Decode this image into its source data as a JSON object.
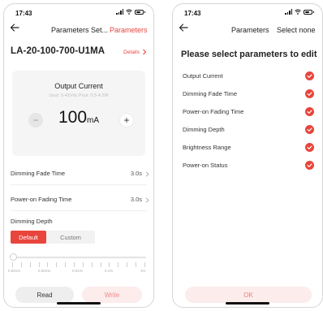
{
  "theme": {
    "accent": "#e8453c",
    "accent_soft": "#fdecec",
    "card_bg": "#f5f5f5"
  },
  "left_screen": {
    "status_time": "17:43",
    "nav_title": "Parameters Set...",
    "nav_action": "Parameters",
    "device_name": "LA-20-100-700-U1MA",
    "details_label": "Details",
    "current_card": {
      "title": "Output Current",
      "subtitle": "Uout: 5-42Vdc  Pout: 0.5-4.2W",
      "value": "100",
      "unit": "mA",
      "minus_label": "−",
      "plus_label": "+"
    },
    "rows": [
      {
        "label": "Dimming Fade Time",
        "value": "3.0s"
      },
      {
        "label": "Power-on Fading Time",
        "value": "3.0s"
      }
    ],
    "dimming_depth": {
      "label": "Dimming Depth",
      "options": [
        "Default",
        "Custom"
      ],
      "selected": "Default",
      "slider_labels": [
        "0.001%",
        "0.001%",
        "0.01%",
        "0.1%",
        "1%"
      ],
      "slider_level": 0
    },
    "buttons": {
      "read": "Read",
      "write": "Write"
    }
  },
  "right_screen": {
    "status_time": "17:43",
    "nav_title": "Parameters",
    "nav_action": "Select none",
    "prompt": "Please select parameters to edit",
    "params": [
      {
        "label": "Output Current",
        "checked": true
      },
      {
        "label": "Dimming Fade Time",
        "checked": true
      },
      {
        "label": "Power-on Fading Time",
        "checked": true
      },
      {
        "label": "Dimming Depth",
        "checked": true
      },
      {
        "label": "Brightness Range",
        "checked": true
      },
      {
        "label": "Power-on Status",
        "checked": true
      }
    ],
    "ok_label": "OK"
  }
}
